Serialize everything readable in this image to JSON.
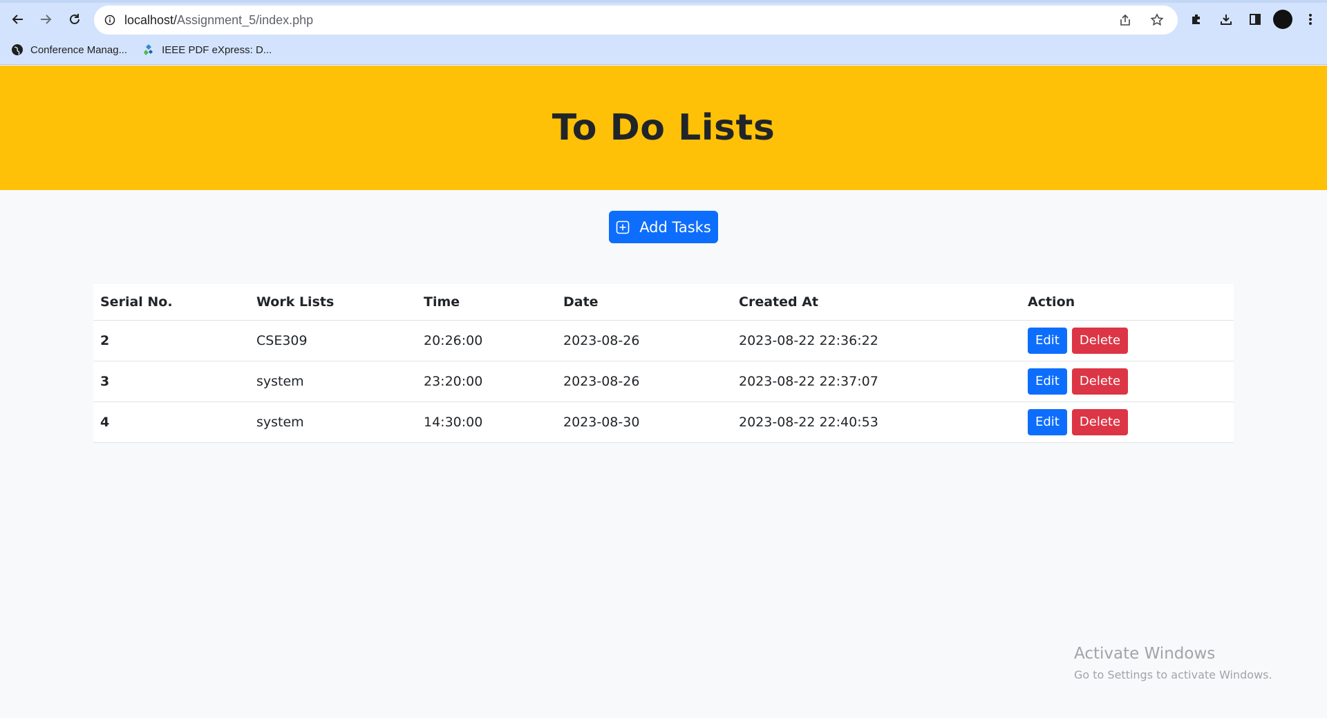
{
  "browser": {
    "url_host": "localhost/",
    "url_path": "Assignment_5/index.php",
    "bookmarks": [
      {
        "label": "Conference Manag...",
        "icon": "globe-icon"
      },
      {
        "label": "IEEE PDF eXpress: D...",
        "icon": "ieee-icon"
      }
    ]
  },
  "page": {
    "title": "To Do Lists",
    "add_button": "Add Tasks"
  },
  "table": {
    "headers": [
      "Serial No.",
      "Work Lists",
      "Time",
      "Date",
      "Created At",
      "Action"
    ],
    "rows": [
      {
        "serial": "2",
        "work": "CSE309",
        "time": "20:26:00",
        "date": "2023-08-26",
        "created": "2023-08-22 22:36:22"
      },
      {
        "serial": "3",
        "work": "system",
        "time": "23:20:00",
        "date": "2023-08-26",
        "created": "2023-08-22 22:37:07"
      },
      {
        "serial": "4",
        "work": "system",
        "time": "14:30:00",
        "date": "2023-08-30",
        "created": "2023-08-22 22:40:53"
      }
    ],
    "edit_label": "Edit",
    "delete_label": "Delete"
  },
  "watermark": {
    "line1": "Activate Windows",
    "line2": "Go to Settings to activate Windows."
  },
  "colors": {
    "hero_bg": "#ffc107",
    "primary": "#0d6efd",
    "danger": "#dc3545"
  }
}
